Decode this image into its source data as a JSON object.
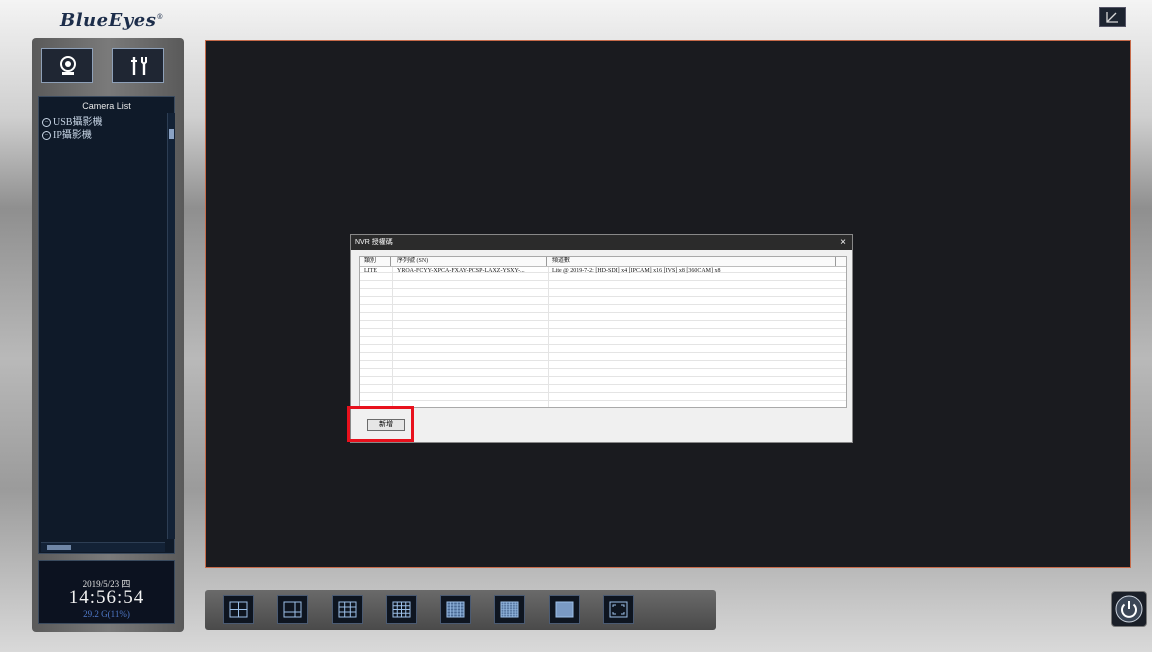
{
  "app": {
    "logo": "BlueEyes",
    "logo_mark": "®"
  },
  "toolbar": {
    "camera_icon": "webcam-icon",
    "settings_icon": "tools-icon",
    "corner_icon": "fullscreen-icon"
  },
  "camera_list": {
    "title": "Camera List",
    "items": [
      {
        "label": "USB攝影機",
        "icon": "collapse-icon"
      },
      {
        "label": "IP攝影機",
        "icon": "collapse-icon"
      }
    ]
  },
  "clock": {
    "date": "2019/5/23 四",
    "time": "14:56:54",
    "disk": "29.2 G(11%)"
  },
  "dialog": {
    "title": "NVR 授權碼",
    "close": "×",
    "columns": [
      "類別",
      "序列號 (SN)",
      "頻道數"
    ],
    "rows": [
      {
        "type": "LITE",
        "sn": "YROA-FCYY-XPCA-FXAY-PCSP-LAXZ-YSXY-...",
        "channels": "Lite @ 2019-7-2: [HD-SDI] x4 [IPCAM] x16 [IVS] x8 [360CAM] x8"
      }
    ],
    "add_button": "新增"
  },
  "layouts": [
    "layout-4",
    "layout-6",
    "layout-9",
    "layout-16",
    "layout-25",
    "layout-36",
    "layout-64",
    "layout-custom"
  ],
  "power": {
    "icon": "power-icon"
  }
}
